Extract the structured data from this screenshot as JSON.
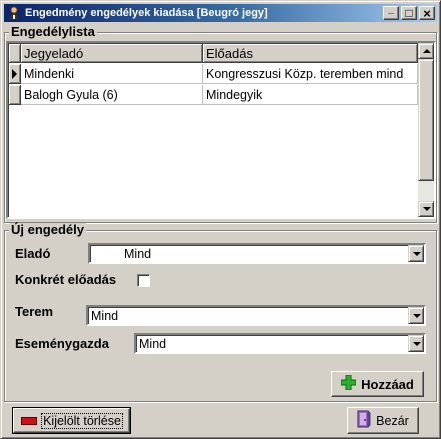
{
  "window": {
    "title": "Engedmény engedélyek kiadása [Beugró jegy]",
    "buttons": {
      "minimize": "_",
      "maximize": "□",
      "close": "×"
    }
  },
  "list_group": {
    "label": "Engedélylista",
    "columns": [
      "Jegyeladó",
      "Előadás"
    ],
    "rows": [
      {
        "seller": "Mindenki",
        "event": "Kongresszusi Közp. teremben mind",
        "current": true
      },
      {
        "seller": "Balogh Gyula (6)",
        "event": "Mindegyik",
        "current": false
      }
    ]
  },
  "new_group": {
    "label": "Új engedély",
    "seller": {
      "label": "Eladó",
      "value": "Mind"
    },
    "specific": {
      "label": "Konkrét előadás",
      "checked": false
    },
    "room": {
      "label": "Terem",
      "value": "Mind"
    },
    "organizer": {
      "label": "Eseménygazda",
      "value": "Mind"
    },
    "add_button": {
      "label": "Hozzáad",
      "icon": "plus-icon"
    }
  },
  "footer": {
    "delete_button": {
      "label": "Kijelölt törlése",
      "icon": "minus-icon"
    },
    "close_button": {
      "label": "Bezár",
      "icon": "door-exit-icon"
    }
  },
  "colors": {
    "title_start": "#0a246a",
    "title_end": "#a6caf0",
    "face": "#d4d0c8",
    "add_green": "#2bb02b",
    "delete_red": "#d01010"
  }
}
